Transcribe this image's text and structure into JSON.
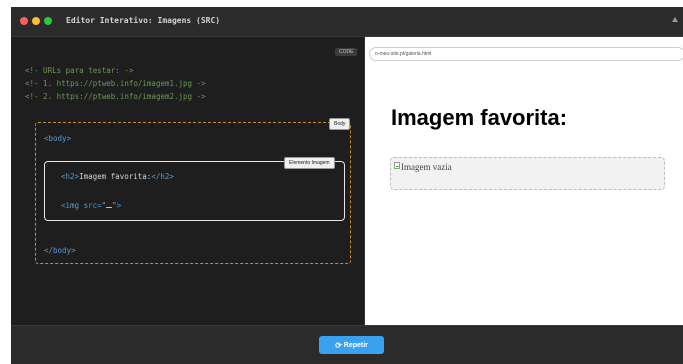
{
  "window": {
    "title": "Editor Interativo: Imagens (SRC)"
  },
  "editor": {
    "code_badge": "CODE",
    "comments": [
      "<!- URLs para testar: ->",
      "<!- 1. https://ptweb.info/imagem1.jpg ->",
      "<!- 2. https://ptweb.info/imagem2.jpg ->"
    ],
    "body_badge": "Body",
    "body_open": "<body>",
    "body_close": "</body>",
    "image_badge": "Elemento Imagem",
    "h2_open": "<h2>",
    "h2_text": "Imagem favorita:",
    "h2_close": "</h2>",
    "img_prefix": "<img src=",
    "img_quote_open": "\"",
    "img_quote_close": "\"",
    "img_suffix": ">"
  },
  "preview": {
    "url": "o-meu-site.pt/galeria.html",
    "heading": "Imagem favorita:",
    "image_alt": "Imagem vazia"
  },
  "footer": {
    "repeat_icon": "⟳",
    "repeat_label": "Repetir"
  },
  "colors": {
    "accent": "#3aa0f0",
    "comment": "#6a9955",
    "keyword": "#569cd6",
    "dashed_border": "#c58a3a"
  }
}
